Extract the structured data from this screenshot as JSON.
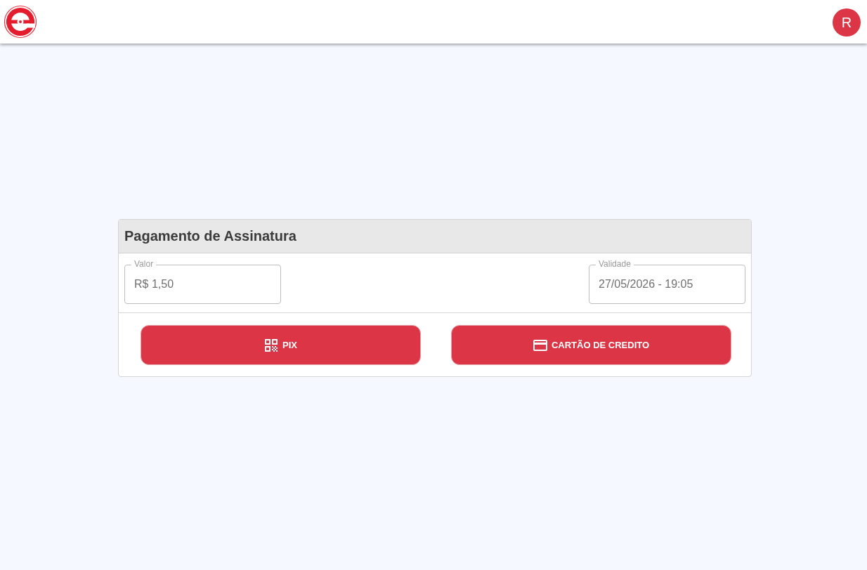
{
  "header": {
    "avatar": {
      "initial": "R"
    }
  },
  "card": {
    "title": "Pagamento de Assinatura",
    "fields": [
      {
        "label": "Valor",
        "value": "R$ 1,50"
      },
      {
        "label": "Validade",
        "value": "27/05/2026 - 19:05"
      }
    ],
    "buttons": [
      {
        "label": "PIX",
        "kind": "pix"
      },
      {
        "label": "CARTÃO DE CREDITO",
        "kind": "card"
      }
    ]
  }
}
